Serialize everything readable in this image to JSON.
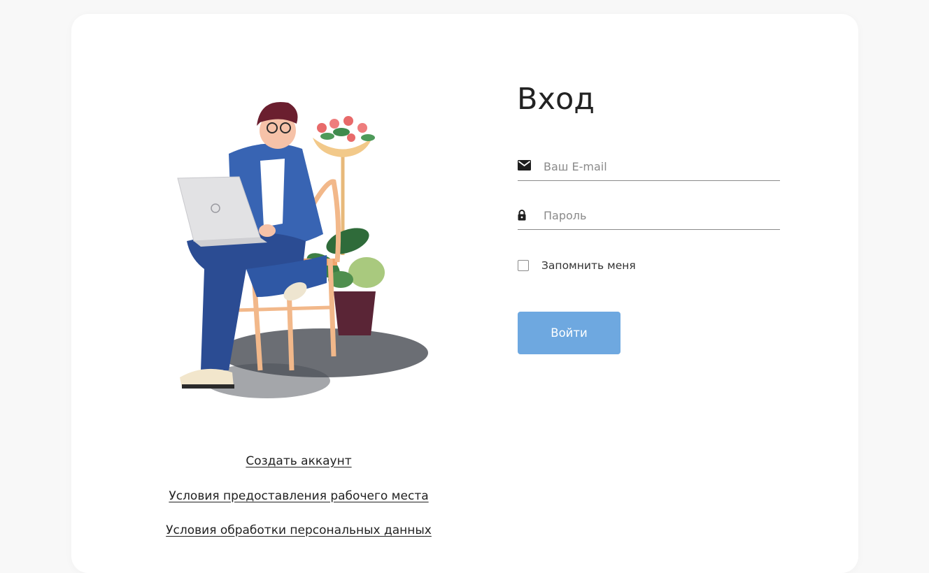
{
  "login": {
    "title": "Вход",
    "email_placeholder": "Ваш E-mail",
    "password_placeholder": "Пароль",
    "remember_label": "Запомнить меня",
    "submit_label": "Войти",
    "email_icon": "envelope-icon",
    "password_icon": "lock-icon"
  },
  "links": {
    "create_account": "Создать аккаунт",
    "workplace_terms": "Условия предоставления рабочего места",
    "personal_data_terms": "Условия обработки персональных данных"
  },
  "colors": {
    "background": "#f8f8f8",
    "card": "#ffffff",
    "button": "#6ea8e0",
    "text": "#222222",
    "placeholder": "#8a8a8a"
  }
}
